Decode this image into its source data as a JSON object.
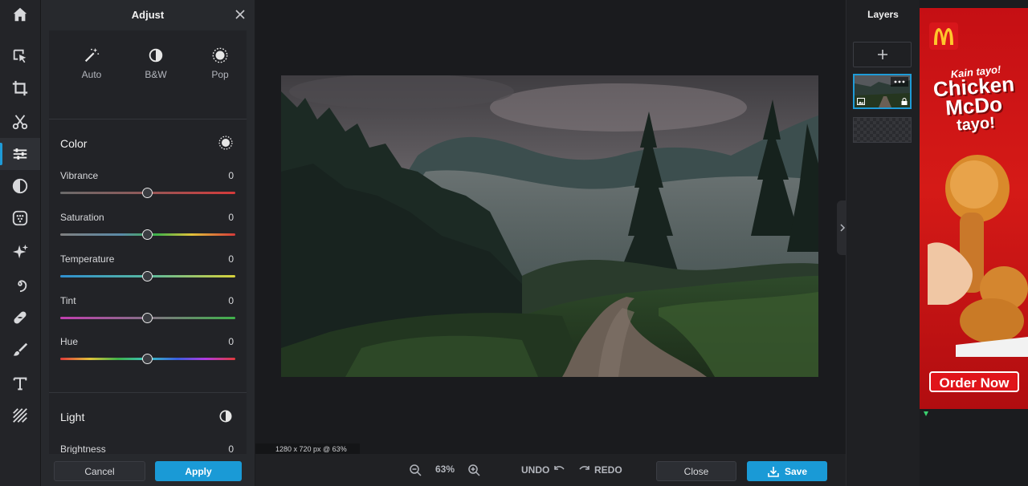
{
  "app": {
    "active_tool": "adjust"
  },
  "toolbar": {
    "tools": [
      "home-icon",
      "select-icon",
      "crop-icon",
      "cut-icon",
      "adjust-icon",
      "filter-icon",
      "effects-icon",
      "retouch-icon",
      "liquify-icon",
      "heal-icon",
      "draw-icon",
      "text-icon",
      "pattern-icon"
    ]
  },
  "panel": {
    "title": "Adjust",
    "quick": [
      {
        "label": "Auto",
        "icon": "magic-wand-icon"
      },
      {
        "label": "B&W",
        "icon": "half-circle-icon"
      },
      {
        "label": "Pop",
        "icon": "pop-icon"
      }
    ],
    "color_section": {
      "title": "Color",
      "sliders": [
        {
          "label": "Vibrance",
          "value": "0"
        },
        {
          "label": "Saturation",
          "value": "0"
        },
        {
          "label": "Temperature",
          "value": "0"
        },
        {
          "label": "Tint",
          "value": "0"
        },
        {
          "label": "Hue",
          "value": "0"
        }
      ]
    },
    "light_section": {
      "title": "Light",
      "sliders": [
        {
          "label": "Brightness",
          "value": "0"
        }
      ]
    },
    "cancel_label": "Cancel",
    "apply_label": "Apply"
  },
  "canvas": {
    "dimensions": "1280 x 720 px @ 63%"
  },
  "bottombar": {
    "zoom": "63%",
    "undo_label": "UNDO",
    "redo_label": "REDO",
    "close_label": "Close",
    "save_label": "Save"
  },
  "layers": {
    "title": "Layers"
  },
  "ad": {
    "tagline": "Kain tayo!",
    "headline1": "Chicken",
    "headline2": "McDo",
    "headline3": "tayo!",
    "cta": "Order Now"
  },
  "colors": {
    "accent": "#1a9ad6",
    "panel_bg": "#27292d",
    "canvas_bg": "#1a1b1e",
    "ad_red": "#c50f14"
  }
}
